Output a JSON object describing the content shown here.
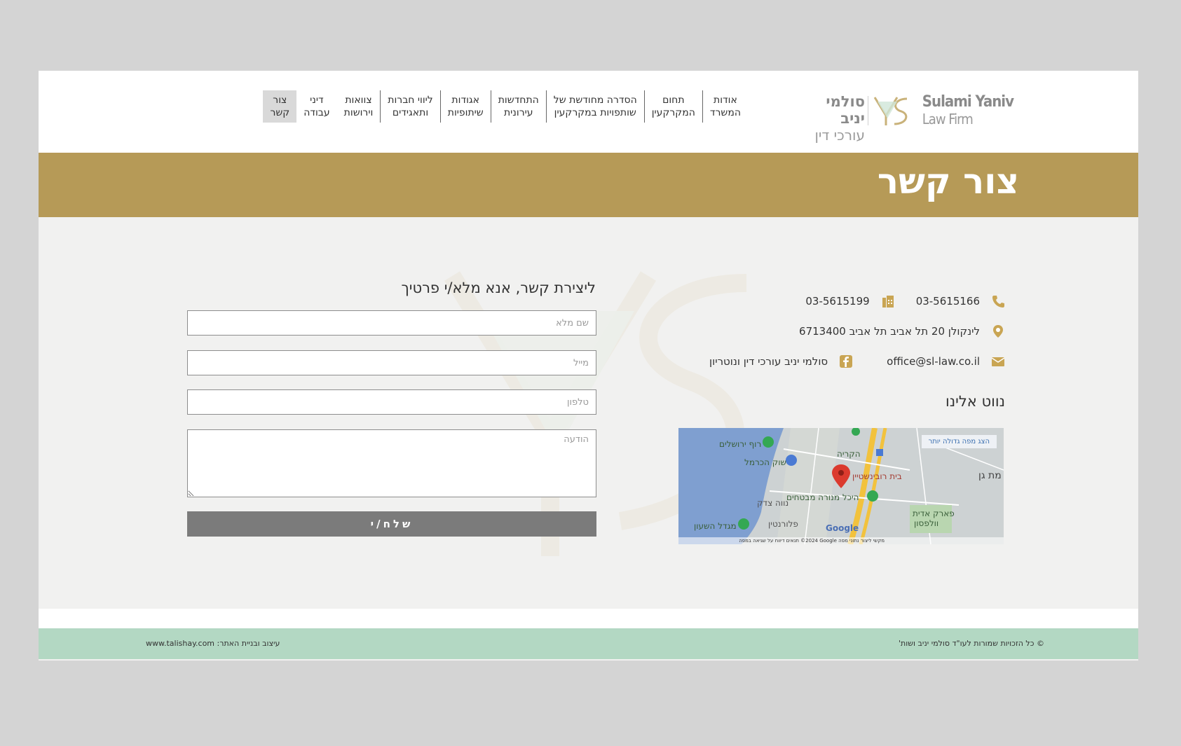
{
  "logo": {
    "en_line1": "Sulami Yaniv",
    "en_line2": "Law Firm",
    "he_line1": "סולמי יניב",
    "he_line2": "עורכי דין"
  },
  "nav": {
    "items": [
      {
        "l1": "אודות",
        "l2": "המשרד"
      },
      {
        "l1": "תחום",
        "l2": "המקרקעין"
      },
      {
        "l1": "הסדרה מחודשת של",
        "l2": "שותפויות במקרקעין"
      },
      {
        "l1": "התחדשות",
        "l2": "עירונית"
      },
      {
        "l1": "אגודות",
        "l2": "שיתופיות"
      },
      {
        "l1": "ליווי חברות",
        "l2": "ותאגידים"
      },
      {
        "l1": "צוואות",
        "l2": "וירושות"
      },
      {
        "l1": "דיני",
        "l2": "עבודה"
      },
      {
        "l1": "צור",
        "l2": "קשר"
      }
    ]
  },
  "page_title": "צור קשר",
  "contact": {
    "phone": "03-5615166",
    "fax": "03-5615199",
    "address": "לינקולן 20 תל אביב תל אביב 6713400",
    "email": "office@sl-law.co.il",
    "facebook": "סולמי יניב עורכי דין ונוטריון",
    "navigate_title": "נווט אלינו"
  },
  "map": {
    "large_map_btn": "הצג מפה גדולה יותר",
    "labels": {
      "roof": "רוף ירושלים",
      "shuk": "שוק הכרמל",
      "kirya": "הקריה",
      "beit": "בית רובינשטיין",
      "ramat": "מת גן",
      "heichal": "היכל מנורה מבטחים",
      "neve": "נווה צדק",
      "florentin": "פלורנטין",
      "park": "פארק אדית",
      "wolfson": "וולפסון",
      "migdal": "מגדל השעון",
      "google": "Google"
    },
    "footer": "מקשי ליצור   נתוני מפה ‎©2024 Google   תנאים   דיווח על שגיאה במפה"
  },
  "form": {
    "title": "ליצירת קשר, אנא מלא/י פרטיך",
    "name_placeholder": "שם מלא",
    "email_placeholder": "מייל",
    "phone_placeholder": "טלפון",
    "message_placeholder": "הודעה",
    "submit_label": "שלח/י"
  },
  "footer": {
    "left": "עיצוב ובניית האתר: www.talishay.com",
    "right": "© כל הזכויות שמורות לעו\"ד סולמי יניב ושות'"
  },
  "colors": {
    "gold": "#b69a57",
    "footer_green": "#b3d8c3",
    "submit_gray": "#7b7b7b"
  }
}
